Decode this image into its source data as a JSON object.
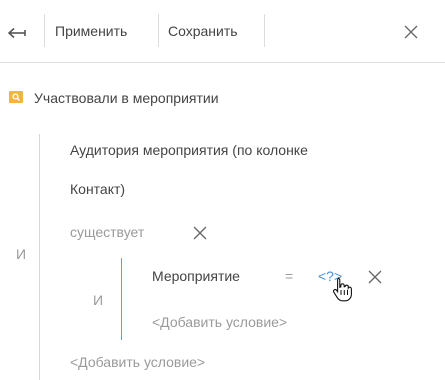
{
  "toolbar": {
    "back_icon": "back-arrow-icon",
    "apply_label": "Применить",
    "save_label": "Сохранить",
    "close_icon": "close-icon"
  },
  "filter": {
    "folder_icon": "search-folder-icon",
    "folder_color": "#f5b53c",
    "group_title": "Участвовали в мероприятии",
    "aggregate_line1": "Аудитория мероприятия (по колонке",
    "aggregate_line2": "Контакт)",
    "exists_label": "существует",
    "outer_operator": "И",
    "inner_operator": "И",
    "condition_column": "Мероприятие",
    "condition_comparison": "=",
    "condition_value": "<?>",
    "value_color": "#4a90d9",
    "add_condition_inner": "<Добавить условие>",
    "add_condition_outer": "<Добавить условие>",
    "accent_bar_color": "#6a9ec8"
  }
}
